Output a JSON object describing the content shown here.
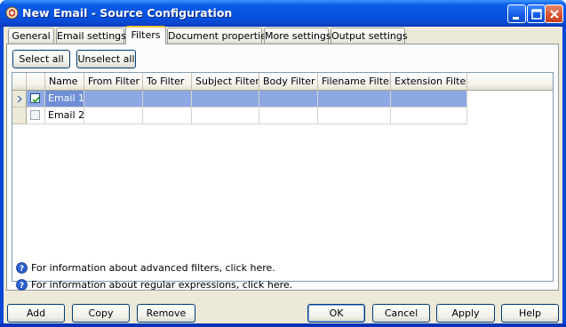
{
  "window": {
    "title": "New Email - Source Configuration"
  },
  "tabs": [
    {
      "label": "General"
    },
    {
      "label": "Email settings"
    },
    {
      "label": "Filters"
    },
    {
      "label": "Document properties"
    },
    {
      "label": "More settings"
    },
    {
      "label": "Output settings"
    }
  ],
  "active_tab": "Filters",
  "toolbar": {
    "select_all_label": "Select all",
    "unselect_all_label": "Unselect all"
  },
  "grid": {
    "columns": [
      "Name",
      "From Filter",
      "To Filter",
      "Subject Filter",
      "Body Filter",
      "Filename Filter",
      "Extension Filter"
    ],
    "rows": [
      {
        "checked": true,
        "selected": true,
        "name": "Email 1"
      },
      {
        "checked": false,
        "selected": false,
        "name": "Email 2"
      }
    ]
  },
  "info": {
    "advanced_filters": "For information about advanced filters, click here.",
    "regular_expressions": "For information about regular expressions, click here."
  },
  "footer": {
    "add_label": "Add",
    "copy_label": "Copy",
    "remove_label": "Remove",
    "ok_label": "OK",
    "cancel_label": "Cancel",
    "apply_label": "Apply",
    "help_label": "Help"
  },
  "colors": {
    "titlebar": "#0553e1",
    "selection": "#8da8e2",
    "tab_highlight": "#ffc73c"
  }
}
